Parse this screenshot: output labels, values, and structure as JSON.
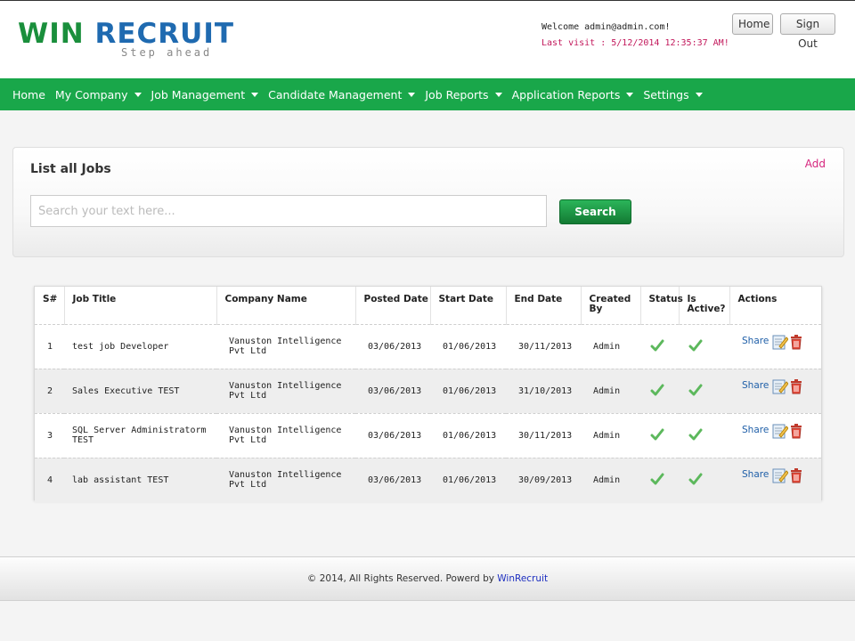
{
  "header": {
    "logo_win": "WIN",
    "logo_recruit": "RECRUIT",
    "logo_tagline": "Step ahead",
    "welcome": "Welcome admin@admin.com!",
    "last_visit": "Last visit : 5/12/2014 12:35:37 AM!",
    "home_label": "Home",
    "signout_label": "Sign Out"
  },
  "nav": {
    "items": [
      {
        "label": "Home",
        "dropdown": false
      },
      {
        "label": "My Company",
        "dropdown": true
      },
      {
        "label": "Job Management",
        "dropdown": true
      },
      {
        "label": "Candidate Management",
        "dropdown": true
      },
      {
        "label": "Job Reports",
        "dropdown": true
      },
      {
        "label": "Application Reports",
        "dropdown": true
      },
      {
        "label": "Settings",
        "dropdown": true
      }
    ]
  },
  "panel": {
    "title": "List all Jobs",
    "add_label": "Add",
    "search_placeholder": "Search your text here...",
    "search_value": "",
    "search_button": "Search"
  },
  "table": {
    "headers": [
      "S#",
      "Job Title",
      "Company Name",
      "Posted Date",
      "Start Date",
      "End Date",
      "Created By",
      "Status",
      "Is Active?",
      "Actions"
    ],
    "share_label": "Share",
    "rows": [
      {
        "sn": "1",
        "title": "test job Developer",
        "company": "Vanuston Intelligence Pvt Ltd",
        "posted": "03/06/2013",
        "start": "01/06/2013",
        "end": "30/11/2013",
        "created_by": "Admin"
      },
      {
        "sn": "2",
        "title": "Sales Executive TEST",
        "company": "Vanuston Intelligence Pvt Ltd",
        "posted": "03/06/2013",
        "start": "01/06/2013",
        "end": "31/10/2013",
        "created_by": "Admin"
      },
      {
        "sn": "3",
        "title": "SQL Server Administratorm TEST",
        "company": "Vanuston Intelligence Pvt Ltd",
        "posted": "03/06/2013",
        "start": "01/06/2013",
        "end": "30/11/2013",
        "created_by": "Admin"
      },
      {
        "sn": "4",
        "title": "lab assistant TEST",
        "company": "Vanuston Intelligence Pvt Ltd",
        "posted": "03/06/2013",
        "start": "01/06/2013",
        "end": "30/09/2013",
        "created_by": "Admin"
      }
    ]
  },
  "footer": {
    "text": "© 2014, All Rights Reserved.  Powerd by ",
    "brand": "WinRecruit"
  },
  "colors": {
    "nav_green": "#19a74a",
    "logo_green": "#1a8f3c",
    "logo_blue": "#1f6ab0",
    "add_pink": "#d6267e",
    "last_visit_red": "#c2185b",
    "check_green": "#5cb85c",
    "delete_red": "#c0392b"
  },
  "icons": {
    "status": "check-icon",
    "active": "check-icon",
    "edit": "edit-icon",
    "delete": "trash-icon"
  }
}
